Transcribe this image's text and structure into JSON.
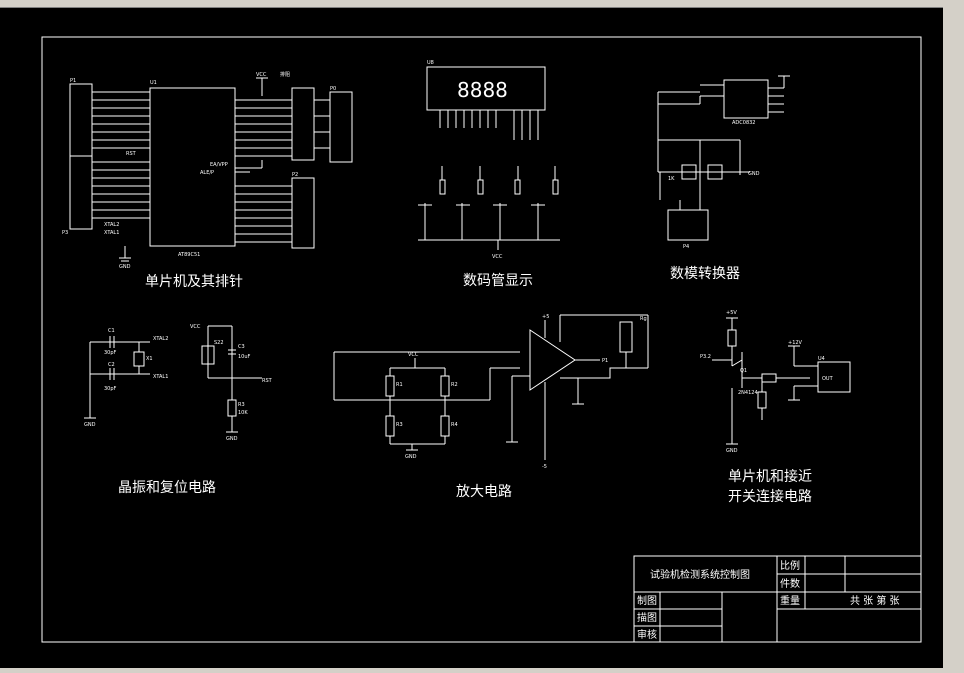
{
  "colors": {
    "background": "#000000",
    "lines": "#ffffff",
    "chrome": "#d4d0c8"
  },
  "captions": {
    "mcu": "单片机及其排针",
    "display": "数码管显示",
    "adc": "数模转换器",
    "crystal_reset": "晶振和复位电路",
    "amplifier": "放大电路",
    "mcu_switch_line1": "单片机和接近",
    "mcu_switch_line2": "开关连接电路"
  },
  "title_block": {
    "drawing_title": "试验机检测系统控制图",
    "scale_label": "比例",
    "quantity_label": "件数",
    "drawn_label": "制图",
    "traced_label": "描图",
    "checked_label": "审核",
    "weight_label": "重量",
    "sheets_label": "共 张 第 张"
  },
  "labels": {
    "u1": "U1",
    "u1_part": "AT89C51",
    "vcc": "VCC",
    "gnd": "GND",
    "p1": "P1",
    "p3": "P3",
    "p0": "P0",
    "p2": "P2",
    "header": "排阻",
    "xtal2": "XTAL2",
    "xtal1": "XTAL1",
    "rst": "RST",
    "ea": "EA/VPP",
    "ale": "ALE/P",
    "u8": "U8",
    "adc_part": "ADC0832",
    "r1k": "1K",
    "p4": "P4",
    "c1": "C1",
    "c2": "C2",
    "c3": "C3",
    "c30pf": "30pF",
    "c10uf": "10uF",
    "x1": "X1",
    "s22": "S22",
    "r3": "R3",
    "r10k": "10K",
    "op_plus": "+5",
    "op_minus": "-5",
    "r_bridge_1": "R1",
    "r_bridge_2": "R2",
    "r_bridge_3": "R3",
    "r_bridge_4": "R4",
    "rg": "Rg",
    "p1out": "P1",
    "v5": "+5V",
    "v12": "+12V",
    "p32": "P3.2",
    "q1": "Q1",
    "q1_part": "2N4124",
    "u4": "U4",
    "u4_out": "OUT"
  }
}
